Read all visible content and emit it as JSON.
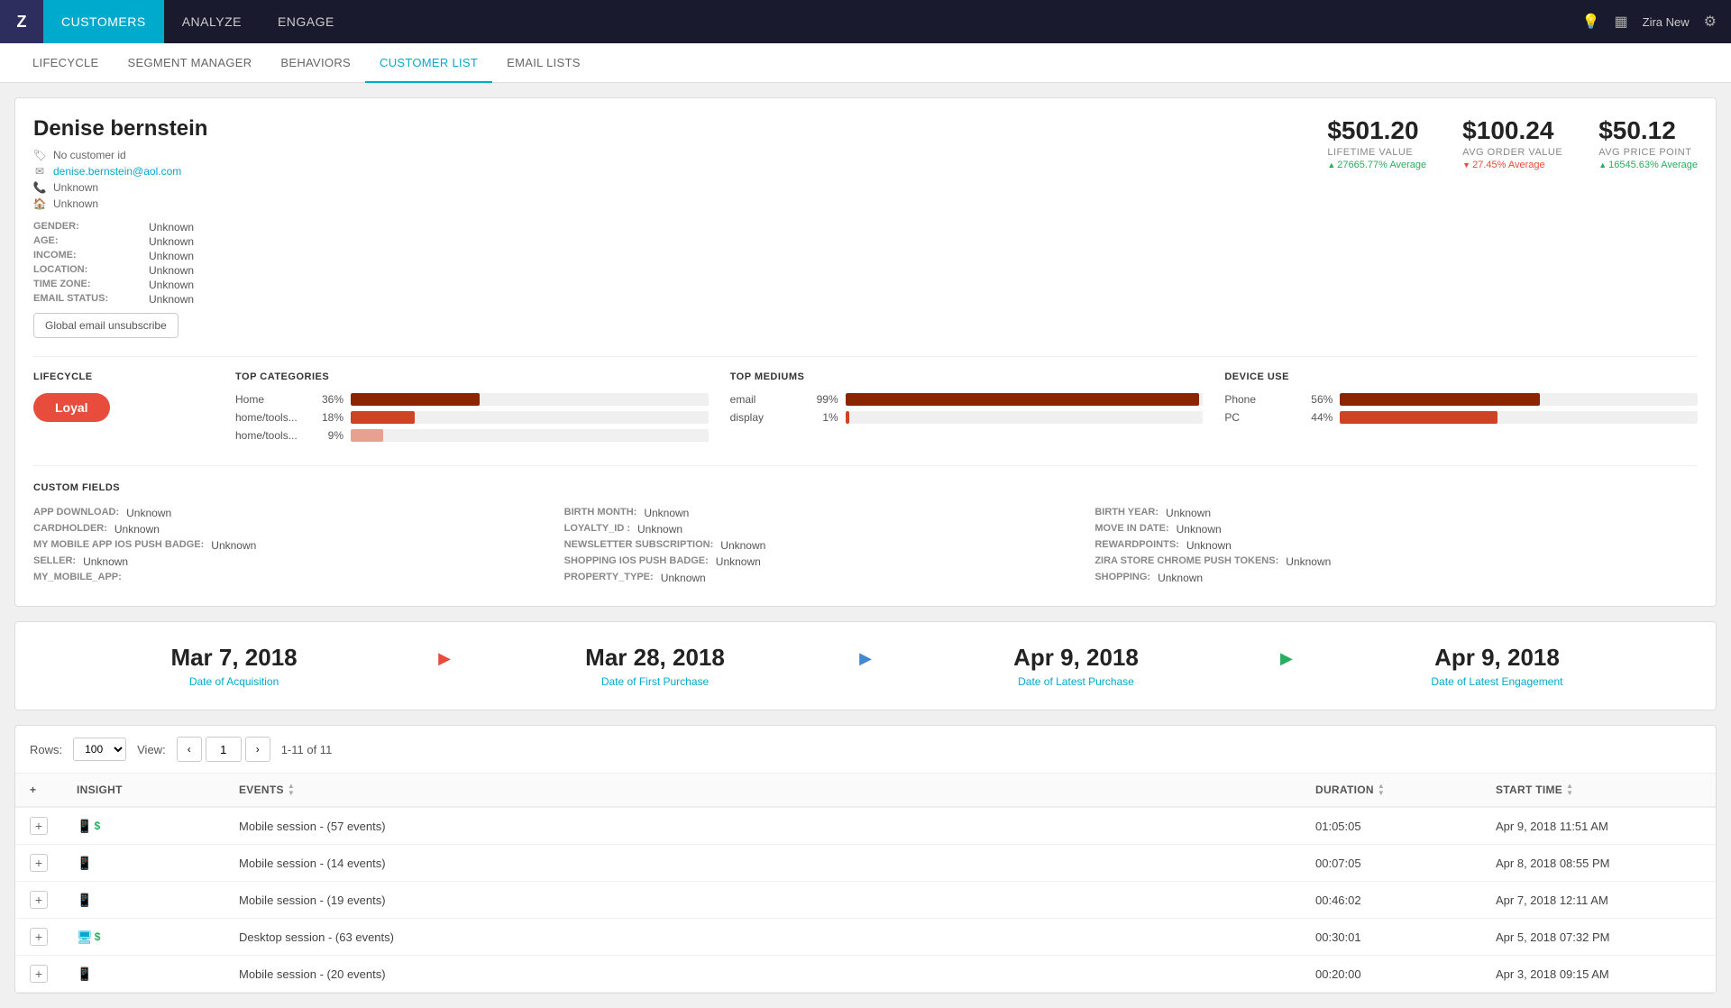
{
  "topNav": {
    "logo": "Z",
    "items": [
      {
        "label": "CUSTOMERS",
        "active": true
      },
      {
        "label": "ANALYZE",
        "active": false
      },
      {
        "label": "ENGAGE",
        "active": false
      }
    ],
    "user": "Zira New",
    "icons": [
      "bulb-icon",
      "layout-icon",
      "settings-icon"
    ]
  },
  "subNav": {
    "items": [
      {
        "label": "LIFECYCLE",
        "active": false
      },
      {
        "label": "SEGMENT MANAGER",
        "active": false
      },
      {
        "label": "BEHAVIORS",
        "active": false
      },
      {
        "label": "CUSTOMER LIST",
        "active": true
      },
      {
        "label": "EMAIL LISTS",
        "active": false
      }
    ]
  },
  "customer": {
    "name": "Denise bernstein",
    "noCustomerId": "No customer id",
    "email": "denise.bernstein@aol.com",
    "phone": "Unknown",
    "location": "Unknown",
    "fields": {
      "gender": {
        "label": "GENDER:",
        "value": "Unknown"
      },
      "age": {
        "label": "AGE:",
        "value": "Unknown"
      },
      "income": {
        "label": "INCOME:",
        "value": "Unknown"
      },
      "location": {
        "label": "LOCATION:",
        "value": "Unknown"
      },
      "timezone": {
        "label": "TIME ZONE:",
        "value": "Unknown"
      },
      "emailStatus": {
        "label": "EMAIL STATUS:",
        "value": "Unknown"
      }
    },
    "unsubscribeLabel": "Global email unsubscribe",
    "metrics": {
      "lifetime": {
        "label": "LIFETIME VALUE",
        "value": "$501.20",
        "change": "27665.77% Average",
        "direction": "up"
      },
      "avgOrder": {
        "label": "AVG ORDER VALUE",
        "value": "$100.24",
        "change": "27.45% Average",
        "direction": "down"
      },
      "avgPrice": {
        "label": "AVG PRICE POINT",
        "value": "$50.12",
        "change": "16545.63% Average",
        "direction": "up"
      }
    }
  },
  "lifecycle": {
    "title": "LIFECYCLE",
    "label": "Loyal"
  },
  "topCategories": {
    "title": "TOP CATEGORIES",
    "items": [
      {
        "label": "Home",
        "pct": 36,
        "display": "36%"
      },
      {
        "label": "home/tools...",
        "pct": 18,
        "display": "18%"
      },
      {
        "label": "home/tools...",
        "pct": 9,
        "display": "9%"
      }
    ]
  },
  "topMediums": {
    "title": "TOP MEDIUMS",
    "items": [
      {
        "label": "email",
        "pct": 99,
        "display": "99%"
      },
      {
        "label": "display",
        "pct": 1,
        "display": "1%"
      }
    ]
  },
  "deviceUse": {
    "title": "DEVICE USE",
    "items": [
      {
        "label": "Phone",
        "pct": 56,
        "display": "56%"
      },
      {
        "label": "PC",
        "pct": 44,
        "display": "44%"
      }
    ]
  },
  "customFields": {
    "title": "CUSTOM FIELDS",
    "col1": [
      {
        "label": "APP DOWNLOAD:",
        "value": "Unknown"
      },
      {
        "label": "CARDHOLDER:",
        "value": "Unknown"
      },
      {
        "label": "MY MOBILE APP IOS PUSH BADGE:",
        "value": "Unknown"
      },
      {
        "label": "SELLER:",
        "value": "Unknown"
      },
      {
        "label": "MY_MOBILE_APP:",
        "value": ""
      }
    ],
    "col2": [
      {
        "label": "BIRTH MONTH:",
        "value": "Unknown"
      },
      {
        "label": "LOYALTY_ID :",
        "value": "Unknown"
      },
      {
        "label": "NEWSLETTER SUBSCRIPTION:",
        "value": "Unknown"
      },
      {
        "label": "SHOPPING IOS PUSH BADGE:",
        "value": "Unknown"
      },
      {
        "label": "PROPERTY_TYPE:",
        "value": "Unknown"
      }
    ],
    "col3": [
      {
        "label": "BIRTH YEAR:",
        "value": "Unknown"
      },
      {
        "label": "MOVE IN DATE:",
        "value": "Unknown"
      },
      {
        "label": "REWARDPOINTS:",
        "value": "Unknown"
      },
      {
        "label": "ZIRA STORE CHROME PUSH TOKENS:",
        "value": "Unknown"
      },
      {
        "label": "SHOPPING:",
        "value": "Unknown"
      }
    ]
  },
  "timeline": {
    "dates": [
      {
        "date": "Mar 7, 2018",
        "label": "Date of Acquisition",
        "arrow": "▶",
        "arrowColor": "orange"
      },
      {
        "date": "Mar 28, 2018",
        "label": "Date of First Purchase",
        "arrow": "▶",
        "arrowColor": "blue"
      },
      {
        "date": "Apr 9, 2018",
        "label": "Date of Latest Purchase",
        "arrow": "▶",
        "arrowColor": "green"
      },
      {
        "date": "Apr 9, 2018",
        "label": "Date of Latest Engagement",
        "arrow": "",
        "arrowColor": ""
      }
    ]
  },
  "tableControls": {
    "rowsLabel": "Rows:",
    "rowsValue": "100",
    "viewLabel": "View:",
    "currentPage": "1",
    "pageInfo": "1-11 of 11"
  },
  "table": {
    "headers": [
      {
        "label": "",
        "sortable": false
      },
      {
        "label": "Insight",
        "sortable": false
      },
      {
        "label": "Events",
        "sortable": true
      },
      {
        "label": "Duration",
        "sortable": true
      },
      {
        "label": "Start Time",
        "sortable": true
      }
    ],
    "rows": [
      {
        "icons": [
          "phone",
          "dollar"
        ],
        "events": "Mobile session - (57 events)",
        "duration": "01:05:05",
        "startTime": "Apr 9, 2018 11:51 AM"
      },
      {
        "icons": [
          "phone"
        ],
        "events": "Mobile session - (14 events)",
        "duration": "00:07:05",
        "startTime": "Apr 8, 2018 08:55 PM"
      },
      {
        "icons": [
          "phone"
        ],
        "events": "Mobile session - (19 events)",
        "duration": "00:46:02",
        "startTime": "Apr 7, 2018 12:11 AM"
      },
      {
        "icons": [
          "desktop",
          "dollar"
        ],
        "events": "Desktop session - (63 events)",
        "duration": "00:30:01",
        "startTime": "Apr 5, 2018 07:32 PM"
      },
      {
        "icons": [
          "phone"
        ],
        "events": "Mobile session - (20 events)",
        "duration": "00:20:00",
        "startTime": "Apr 3, 2018 09:15 AM"
      }
    ]
  }
}
